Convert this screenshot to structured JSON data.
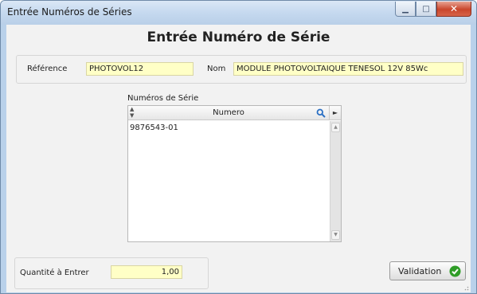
{
  "window": {
    "title": "Entrée Numéros de Séries",
    "minimize_glyph": "▁",
    "maximize_glyph": "□",
    "close_glyph": "✕"
  },
  "form": {
    "heading": "Entrée Numéro de Série",
    "reference_label": "Référence",
    "reference_value": "PHOTOVOL12",
    "nom_label": "Nom",
    "nom_value": "MODULE PHOTOVOLTAIQUE TENESOL 12V 85Wc",
    "serial_list_label": "Numéros de Série",
    "quantity_label": "Quantité à Entrer",
    "quantity_value": "1,00",
    "validate_label": "Validation"
  },
  "table": {
    "sort_glyph": "▲\n▼",
    "column_header": "Numero",
    "menu_glyph": "►",
    "rows": [
      "9876543-01"
    ],
    "scroll_up_glyph": "▲",
    "scroll_down_glyph": "▼"
  },
  "icons": {
    "search": "search-icon",
    "check": "check-icon",
    "close": "close-icon",
    "minimize": "minimize-icon",
    "maximize": "maximize-icon"
  },
  "colors": {
    "field_bg": "#ffffc6",
    "check_green": "#2f9d27",
    "close_red": "#c9462c",
    "titlebar": "#c5d9ef"
  }
}
